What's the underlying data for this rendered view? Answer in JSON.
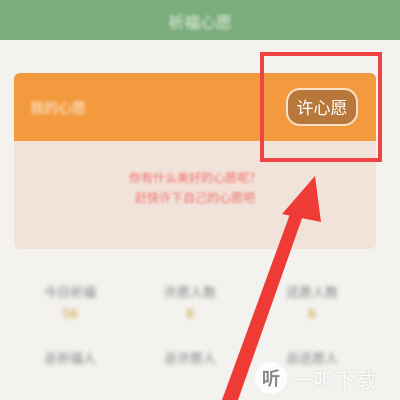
{
  "header": {
    "title": "祈福心愿"
  },
  "card": {
    "label": "我的心愿",
    "wish_button": "许心愿",
    "body_line1": "你有什么美好的心愿呢？",
    "body_line2": "赶快许下自己的心愿吧"
  },
  "stats": [
    {
      "label": "今日祈福",
      "value": "56"
    },
    {
      "label": "许愿人数",
      "value": "8"
    },
    {
      "label": "还愿人数",
      "value": "6"
    },
    {
      "label": "总祈福人",
      "value": ""
    },
    {
      "label": "总许愿人",
      "value": ""
    },
    {
      "label": "总还愿人",
      "value": ""
    }
  ],
  "watermark": {
    "logo": "听",
    "text": "一听下载"
  },
  "colors": {
    "header": "#7aac7c",
    "card_header": "#f29a3d",
    "highlight": "#f04444"
  }
}
